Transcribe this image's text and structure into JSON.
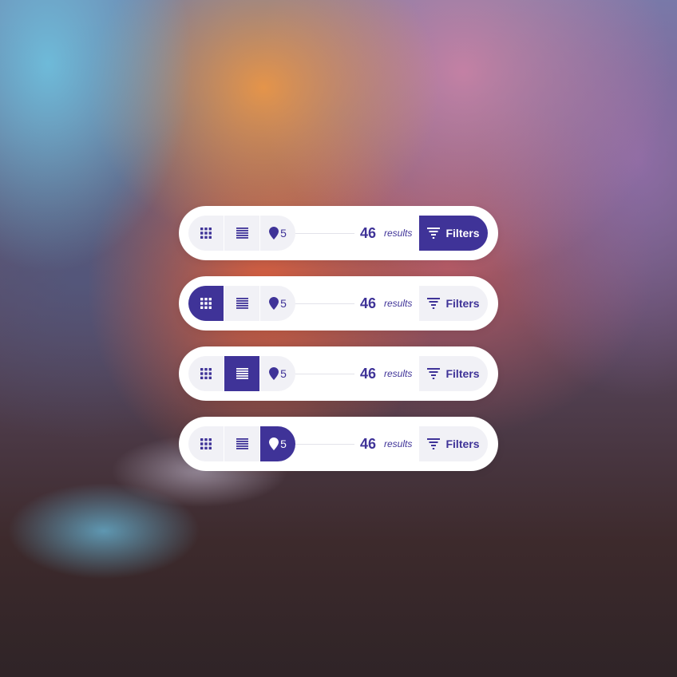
{
  "colors": {
    "accent": "#3f3398",
    "segment_bg": "#f1f1f6",
    "bar_bg": "#ffffff"
  },
  "toolbars": [
    {
      "active": "filters",
      "pin_count": "5",
      "results_count": "46",
      "results_label": "results",
      "filters_label": "Filters"
    },
    {
      "active": "grid",
      "pin_count": "5",
      "results_count": "46",
      "results_label": "results",
      "filters_label": "Filters"
    },
    {
      "active": "list",
      "pin_count": "5",
      "results_count": "46",
      "results_label": "results",
      "filters_label": "Filters"
    },
    {
      "active": "map",
      "pin_count": "5",
      "results_count": "46",
      "results_label": "results",
      "filters_label": "Filters"
    }
  ],
  "icons": {
    "grid": "grid-view-icon",
    "list": "list-view-icon",
    "map": "map-pin-icon",
    "filter": "filter-icon"
  }
}
